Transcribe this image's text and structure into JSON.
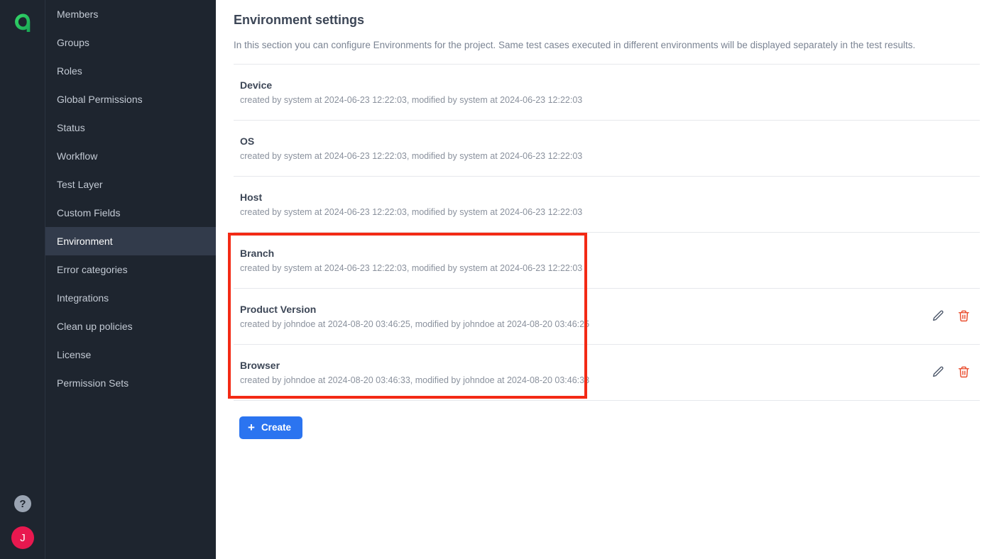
{
  "brand": {
    "logo_icon": "allure-a-logo-icon",
    "logo_color": "#2ec866"
  },
  "rail": {
    "help_icon": "help-question-icon",
    "help_label": "?",
    "avatar_initial": "J",
    "avatar_color": "#e8184f"
  },
  "sidebar": {
    "items": [
      {
        "label": "Members",
        "active": false
      },
      {
        "label": "Groups",
        "active": false
      },
      {
        "label": "Roles",
        "active": false
      },
      {
        "label": "Global Permissions",
        "active": false
      },
      {
        "label": "Status",
        "active": false
      },
      {
        "label": "Workflow",
        "active": false
      },
      {
        "label": "Test Layer",
        "active": false
      },
      {
        "label": "Custom Fields",
        "active": false
      },
      {
        "label": "Environment",
        "active": true
      },
      {
        "label": "Error categories",
        "active": false
      },
      {
        "label": "Integrations",
        "active": false
      },
      {
        "label": "Clean up policies",
        "active": false
      },
      {
        "label": "License",
        "active": false
      },
      {
        "label": "Permission Sets",
        "active": false
      }
    ]
  },
  "main": {
    "title": "Environment settings",
    "description": "In this section you can configure Environments for the project. Same test cases executed in different environments will be displayed separately in the test results.",
    "environments": [
      {
        "name": "Device",
        "meta": "created by system at 2024-06-23 12:22:03, modified by system at 2024-06-23 12:22:03",
        "has_actions": false
      },
      {
        "name": "OS",
        "meta": "created by system at 2024-06-23 12:22:03, modified by system at 2024-06-23 12:22:03",
        "has_actions": false
      },
      {
        "name": "Host",
        "meta": "created by system at 2024-06-23 12:22:03, modified by system at 2024-06-23 12:22:03",
        "has_actions": false
      },
      {
        "name": "Branch",
        "meta": "created by system at 2024-06-23 12:22:03, modified by system at 2024-06-23 12:22:03",
        "has_actions": false
      },
      {
        "name": "Product Version",
        "meta": "created by johndoe at 2024-08-20 03:46:25, modified by johndoe at 2024-08-20 03:46:25",
        "has_actions": true
      },
      {
        "name": "Browser",
        "meta": "created by johndoe at 2024-08-20 03:46:33, modified by johndoe at 2024-08-20 03:46:33",
        "has_actions": true
      }
    ],
    "row_actions": {
      "edit_icon": "pencil-edit-icon",
      "delete_icon": "trash-delete-icon",
      "edit_color": "#4a5568",
      "delete_color": "#e8401f"
    },
    "create_button": {
      "label": "Create",
      "plus": "+",
      "color": "#2b74f0"
    }
  },
  "annotation": {
    "color": "#f32a15"
  }
}
